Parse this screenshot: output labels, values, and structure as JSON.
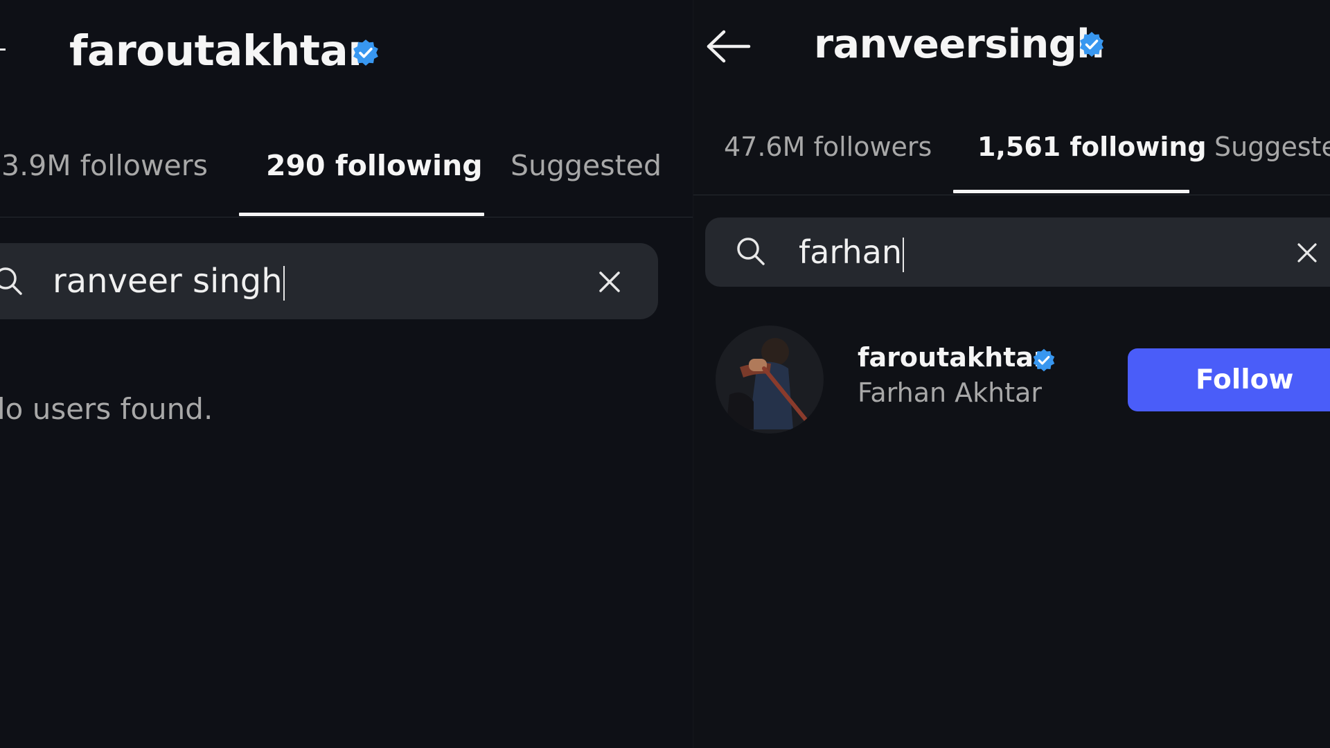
{
  "colors": {
    "background": "#0e1016",
    "search_bg": "#25282e",
    "verified_badge": "#3897f0",
    "follow_button": "#4a5df9",
    "tab_inactive_text": "#a8a8a8",
    "text_primary": "#f5f5f5"
  },
  "left": {
    "username": "faroutakhtar",
    "tabs": [
      {
        "label": "3.9M followers"
      },
      {
        "label": "290 following",
        "active": true
      },
      {
        "label": "Suggested"
      }
    ],
    "search": {
      "value": "ranveer singh",
      "clear_icon": "close-icon",
      "search_icon": "search-icon"
    },
    "empty_message": "lo users found."
  },
  "right": {
    "username": "ranveersingh",
    "back_icon": "arrow-left-icon",
    "tabs": [
      {
        "label": "47.6M followers"
      },
      {
        "label": "1,561 following",
        "active": true
      },
      {
        "label": "Suggeste"
      }
    ],
    "search": {
      "value": "farhan",
      "clear_icon": "close-icon",
      "search_icon": "search-icon"
    },
    "result": {
      "username": "faroutakhtar",
      "full_name": "Farhan Akhtar",
      "button_label": "Follow",
      "avatar_icon": "profile-photo"
    }
  }
}
